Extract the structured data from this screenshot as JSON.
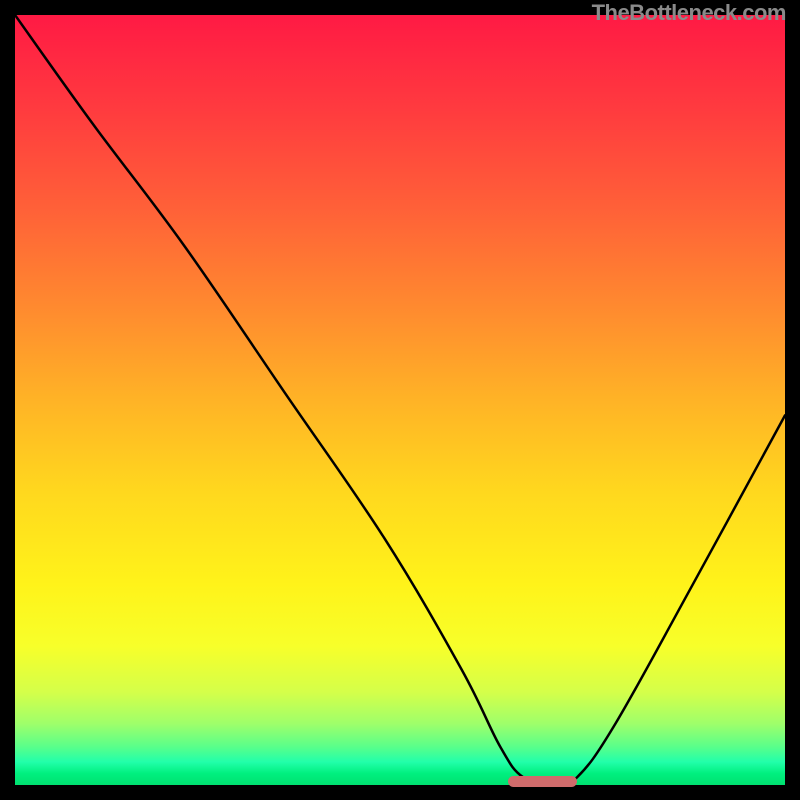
{
  "watermark": "TheBottleneck.com",
  "chart_data": {
    "type": "line",
    "title": "",
    "xlabel": "",
    "ylabel": "",
    "xlim": [
      0,
      100
    ],
    "ylim": [
      0,
      100
    ],
    "grid": false,
    "series": [
      {
        "name": "bottleneck-curve",
        "x": [
          0,
          10,
          22,
          35,
          48,
          58,
          63,
          66,
          70,
          73,
          78,
          88,
          100
        ],
        "y": [
          100,
          86,
          70,
          51,
          32,
          15,
          5,
          1,
          0,
          1,
          8,
          26,
          48
        ]
      }
    ],
    "optimal_marker": {
      "x_start": 64,
      "x_end": 73,
      "y": 0
    },
    "gradient_stops": [
      {
        "pos": 0,
        "color": "#ff1a44"
      },
      {
        "pos": 25,
        "color": "#ff6038"
      },
      {
        "pos": 50,
        "color": "#ffb326"
      },
      {
        "pos": 74,
        "color": "#fff31a"
      },
      {
        "pos": 92,
        "color": "#9fff6a"
      },
      {
        "pos": 100,
        "color": "#00e070"
      }
    ]
  }
}
